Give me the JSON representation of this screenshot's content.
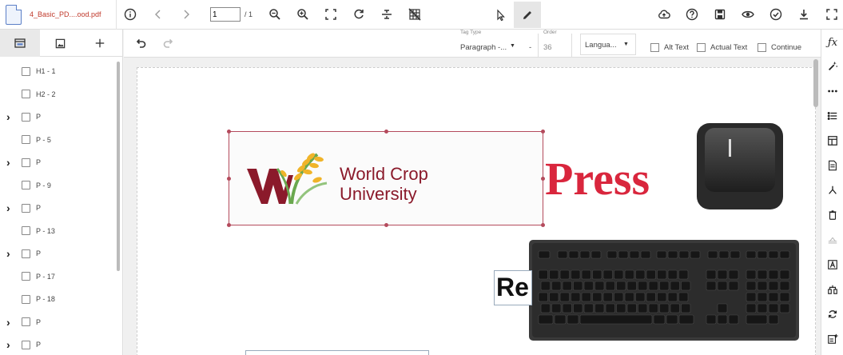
{
  "topbar": {
    "file_name": "4_Basic_PD....ood.pdf",
    "page_value": "1",
    "page_total": "/ 1"
  },
  "icons": {
    "info": "info-icon",
    "prev": "chevron-left-icon",
    "next": "chevron-right-icon",
    "zoom_out": "zoom-out-icon",
    "zoom_in": "zoom-in-icon",
    "fit": "fit-screen-icon",
    "rotate": "rotate-icon",
    "split": "split-icon",
    "grid": "grid-off-icon",
    "select": "pointer-icon",
    "edit": "pencil-icon",
    "upload": "cloud-upload-icon",
    "help": "help-icon",
    "save": "save-icon",
    "preview": "eye-icon",
    "check": "check-circle-icon",
    "download": "download-icon",
    "fullscreen": "fullscreen-icon"
  },
  "sidebar": {
    "tabs": [
      "tags-tab",
      "image-tab",
      "add-tab"
    ],
    "tree": [
      {
        "label": "H1 - 1",
        "expandable": false
      },
      {
        "label": "H2 - 2",
        "expandable": false
      },
      {
        "label": "P",
        "expandable": true
      },
      {
        "label": "P - 5",
        "expandable": false
      },
      {
        "label": "P",
        "expandable": true
      },
      {
        "label": "P - 9",
        "expandable": false
      },
      {
        "label": "P",
        "expandable": true
      },
      {
        "label": "P - 13",
        "expandable": false
      },
      {
        "label": "P",
        "expandable": true
      },
      {
        "label": "P - 17",
        "expandable": false
      },
      {
        "label": "P - 18",
        "expandable": false
      },
      {
        "label": "P",
        "expandable": true
      },
      {
        "label": "P",
        "expandable": true
      }
    ]
  },
  "subbar": {
    "tag_type_label": "Tag Type",
    "tag_type_value": "Paragraph -...",
    "order_label": "Order",
    "order_value": "36",
    "order_dash": "-",
    "language_value": "Langua...",
    "alt_text": "Alt Text",
    "actual_text": "Actual Text",
    "continue": "Continue"
  },
  "document": {
    "logo_line1": "World Crop",
    "logo_line2": "University",
    "press_text": "Press",
    "re_text": "Re"
  },
  "colors": {
    "logo_red": "#8b1a2b",
    "press_red": "#d9263d",
    "selection": "#b44a5c",
    "wheat_yellow": "#f0b429"
  }
}
